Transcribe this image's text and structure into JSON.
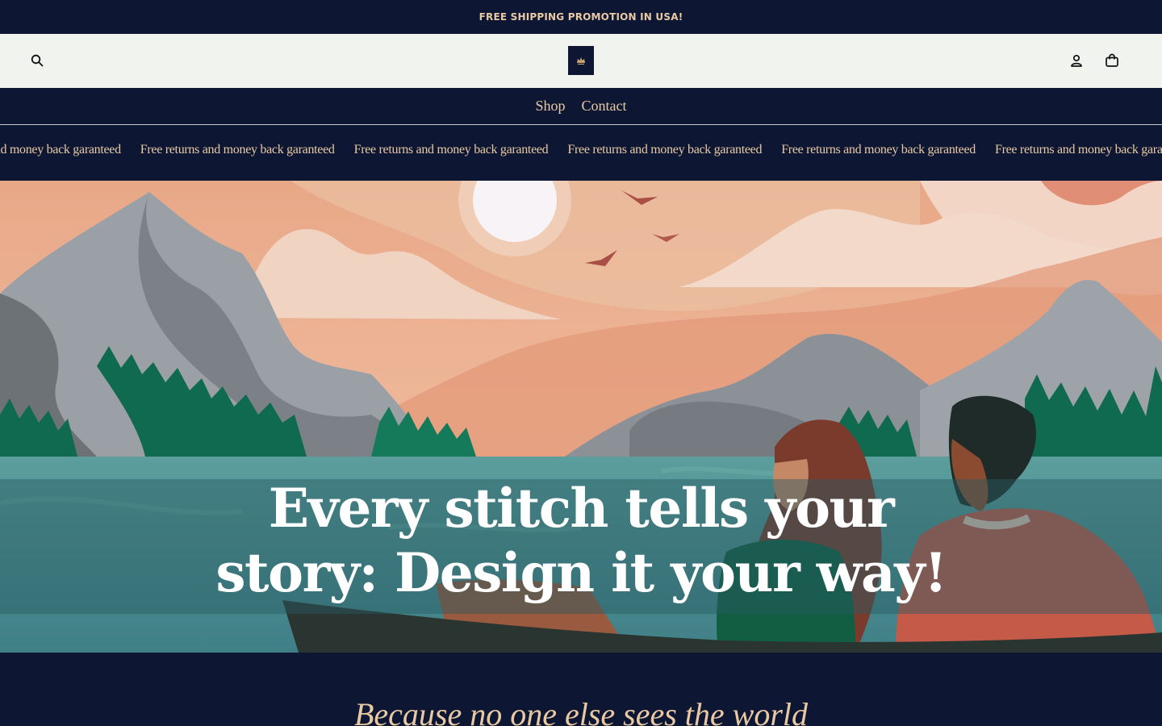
{
  "announcement": {
    "text": "FREE SHIPPING PROMOTION IN USA!"
  },
  "header": {
    "search_icon": "search-icon",
    "logo": "store-logo",
    "account_icon": "user-icon",
    "cart_icon": "shopping-bag-icon"
  },
  "nav": {
    "items": [
      {
        "label": "Shop"
      },
      {
        "label": "Contact"
      }
    ]
  },
  "marquee": {
    "text": "Free returns and money back garanteed",
    "items": [
      "Free returns and money back garanteed",
      "Free returns and money back garanteed",
      "Free returns and money back garanteed",
      "Free returns and money back garanteed",
      "Free returns and money back garanteed",
      "Free returns and money back garanteed"
    ]
  },
  "hero": {
    "line1": "Every stitch tells your",
    "line2": "story: Design it your way!"
  },
  "tagline": {
    "text": "Because no one else sees the world"
  },
  "colors": {
    "navy": "#0d1733",
    "gold": "#e9c9a4",
    "header_bg": "#f1f3ef"
  }
}
